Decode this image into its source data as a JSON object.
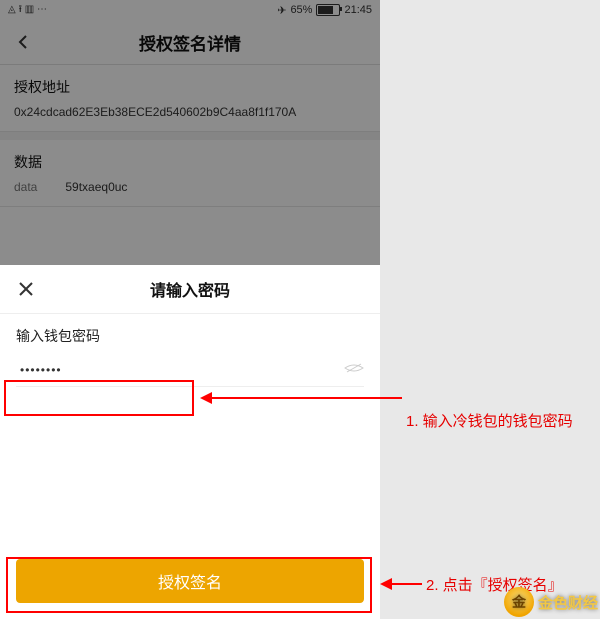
{
  "status": {
    "left_icons": "◬ ⭱ ▥ ⋯",
    "airplane_icon": "✈",
    "battery_pct_text": "65%",
    "battery_pct": 65,
    "time": "21:45"
  },
  "nav": {
    "title": "授权签名详情"
  },
  "address_section": {
    "label": "授权地址",
    "value": "0x24cdcad62E3Eb38ECE2d540602b9C4aa8f1f170A"
  },
  "data_section": {
    "label": "数据",
    "key": "data",
    "value": "59txaeq0uc"
  },
  "sheet": {
    "title": "请输入密码",
    "input_label": "输入钱包密码",
    "password_value": "••••••••",
    "action_label": "授权签名"
  },
  "annotations": {
    "step1": "1. 输入冷钱包的钱包密码",
    "step2": "2. 点击『授权签名』"
  },
  "watermark": {
    "logo_text": "金",
    "brand": "金色财经"
  }
}
